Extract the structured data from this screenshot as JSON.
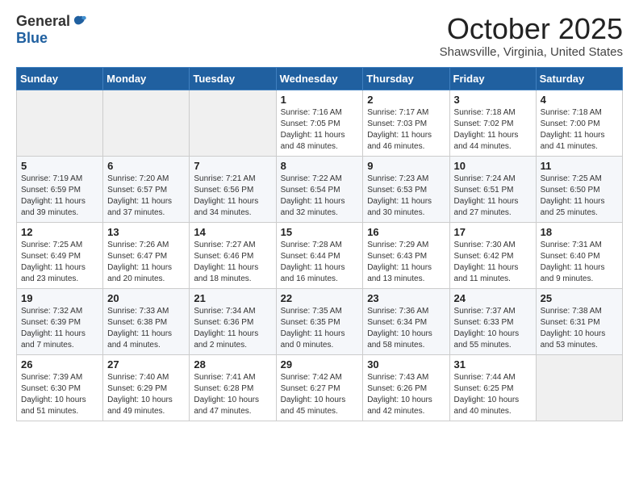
{
  "logo": {
    "general": "General",
    "blue": "Blue"
  },
  "title": "October 2025",
  "location": "Shawsville, Virginia, United States",
  "days_of_week": [
    "Sunday",
    "Monday",
    "Tuesday",
    "Wednesday",
    "Thursday",
    "Friday",
    "Saturday"
  ],
  "weeks": [
    [
      {
        "day": "",
        "info": ""
      },
      {
        "day": "",
        "info": ""
      },
      {
        "day": "",
        "info": ""
      },
      {
        "day": "1",
        "info": "Sunrise: 7:16 AM\nSunset: 7:05 PM\nDaylight: 11 hours and 48 minutes."
      },
      {
        "day": "2",
        "info": "Sunrise: 7:17 AM\nSunset: 7:03 PM\nDaylight: 11 hours and 46 minutes."
      },
      {
        "day": "3",
        "info": "Sunrise: 7:18 AM\nSunset: 7:02 PM\nDaylight: 11 hours and 44 minutes."
      },
      {
        "day": "4",
        "info": "Sunrise: 7:18 AM\nSunset: 7:00 PM\nDaylight: 11 hours and 41 minutes."
      }
    ],
    [
      {
        "day": "5",
        "info": "Sunrise: 7:19 AM\nSunset: 6:59 PM\nDaylight: 11 hours and 39 minutes."
      },
      {
        "day": "6",
        "info": "Sunrise: 7:20 AM\nSunset: 6:57 PM\nDaylight: 11 hours and 37 minutes."
      },
      {
        "day": "7",
        "info": "Sunrise: 7:21 AM\nSunset: 6:56 PM\nDaylight: 11 hours and 34 minutes."
      },
      {
        "day": "8",
        "info": "Sunrise: 7:22 AM\nSunset: 6:54 PM\nDaylight: 11 hours and 32 minutes."
      },
      {
        "day": "9",
        "info": "Sunrise: 7:23 AM\nSunset: 6:53 PM\nDaylight: 11 hours and 30 minutes."
      },
      {
        "day": "10",
        "info": "Sunrise: 7:24 AM\nSunset: 6:51 PM\nDaylight: 11 hours and 27 minutes."
      },
      {
        "day": "11",
        "info": "Sunrise: 7:25 AM\nSunset: 6:50 PM\nDaylight: 11 hours and 25 minutes."
      }
    ],
    [
      {
        "day": "12",
        "info": "Sunrise: 7:25 AM\nSunset: 6:49 PM\nDaylight: 11 hours and 23 minutes."
      },
      {
        "day": "13",
        "info": "Sunrise: 7:26 AM\nSunset: 6:47 PM\nDaylight: 11 hours and 20 minutes."
      },
      {
        "day": "14",
        "info": "Sunrise: 7:27 AM\nSunset: 6:46 PM\nDaylight: 11 hours and 18 minutes."
      },
      {
        "day": "15",
        "info": "Sunrise: 7:28 AM\nSunset: 6:44 PM\nDaylight: 11 hours and 16 minutes."
      },
      {
        "day": "16",
        "info": "Sunrise: 7:29 AM\nSunset: 6:43 PM\nDaylight: 11 hours and 13 minutes."
      },
      {
        "day": "17",
        "info": "Sunrise: 7:30 AM\nSunset: 6:42 PM\nDaylight: 11 hours and 11 minutes."
      },
      {
        "day": "18",
        "info": "Sunrise: 7:31 AM\nSunset: 6:40 PM\nDaylight: 11 hours and 9 minutes."
      }
    ],
    [
      {
        "day": "19",
        "info": "Sunrise: 7:32 AM\nSunset: 6:39 PM\nDaylight: 11 hours and 7 minutes."
      },
      {
        "day": "20",
        "info": "Sunrise: 7:33 AM\nSunset: 6:38 PM\nDaylight: 11 hours and 4 minutes."
      },
      {
        "day": "21",
        "info": "Sunrise: 7:34 AM\nSunset: 6:36 PM\nDaylight: 11 hours and 2 minutes."
      },
      {
        "day": "22",
        "info": "Sunrise: 7:35 AM\nSunset: 6:35 PM\nDaylight: 11 hours and 0 minutes."
      },
      {
        "day": "23",
        "info": "Sunrise: 7:36 AM\nSunset: 6:34 PM\nDaylight: 10 hours and 58 minutes."
      },
      {
        "day": "24",
        "info": "Sunrise: 7:37 AM\nSunset: 6:33 PM\nDaylight: 10 hours and 55 minutes."
      },
      {
        "day": "25",
        "info": "Sunrise: 7:38 AM\nSunset: 6:31 PM\nDaylight: 10 hours and 53 minutes."
      }
    ],
    [
      {
        "day": "26",
        "info": "Sunrise: 7:39 AM\nSunset: 6:30 PM\nDaylight: 10 hours and 51 minutes."
      },
      {
        "day": "27",
        "info": "Sunrise: 7:40 AM\nSunset: 6:29 PM\nDaylight: 10 hours and 49 minutes."
      },
      {
        "day": "28",
        "info": "Sunrise: 7:41 AM\nSunset: 6:28 PM\nDaylight: 10 hours and 47 minutes."
      },
      {
        "day": "29",
        "info": "Sunrise: 7:42 AM\nSunset: 6:27 PM\nDaylight: 10 hours and 45 minutes."
      },
      {
        "day": "30",
        "info": "Sunrise: 7:43 AM\nSunset: 6:26 PM\nDaylight: 10 hours and 42 minutes."
      },
      {
        "day": "31",
        "info": "Sunrise: 7:44 AM\nSunset: 6:25 PM\nDaylight: 10 hours and 40 minutes."
      },
      {
        "day": "",
        "info": ""
      }
    ]
  ]
}
